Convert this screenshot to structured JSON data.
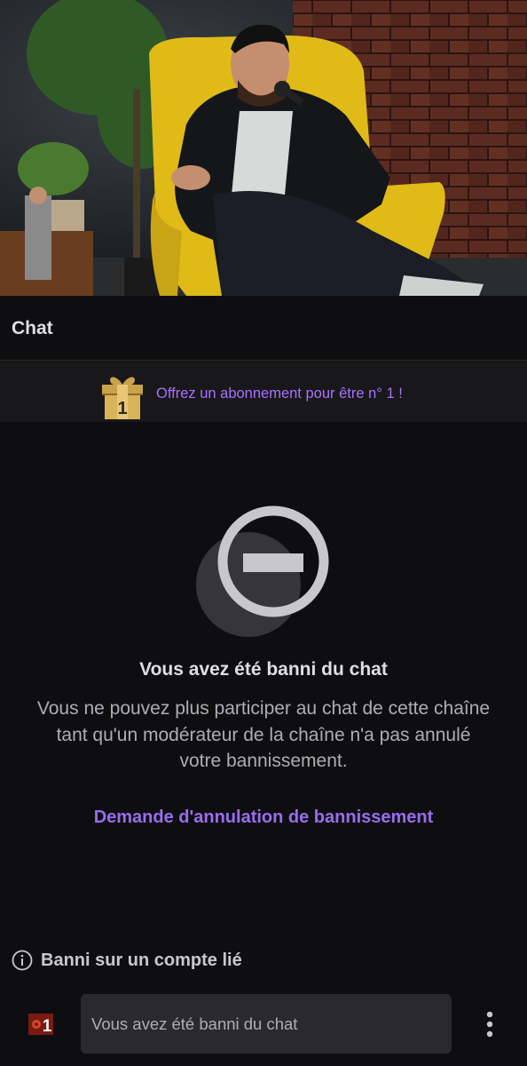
{
  "chat": {
    "title": "Chat"
  },
  "gift_banner": {
    "rank": "1",
    "text": "Offrez un abonnement pour être n° 1 !"
  },
  "banned": {
    "title": "Vous avez été banni du chat",
    "description": "Vous ne pouvez plus participer au chat de cette chaîne tant qu'un modérateur de la chaîne n'a pas annulé votre bannissement.",
    "appeal_link": "Demande d'annulation de bannissement"
  },
  "linked_account": {
    "text": "Banni sur un compte lié"
  },
  "input": {
    "placeholder": "Vous avez été banni du chat"
  },
  "bits_badge": {
    "count": "1"
  },
  "colors": {
    "accent": "#a970ff",
    "background": "#0e0e10",
    "input_bg": "#2a2a2d"
  },
  "icons": {
    "gift": "gift-icon",
    "ban": "ban-icon",
    "info": "info-icon",
    "more": "more-vertical-icon"
  }
}
